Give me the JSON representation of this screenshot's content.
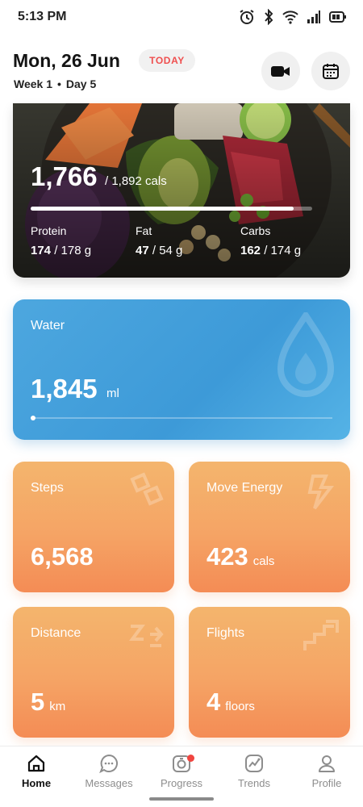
{
  "status_bar": {
    "time": "5:13 PM",
    "icons": [
      "alarm-icon",
      "bluetooth-icon",
      "wifi-icon",
      "signal-icon",
      "battery-icon"
    ]
  },
  "header": {
    "date": "Mon, 26 Jun",
    "badge": "TODAY",
    "week": "Week 1",
    "separator": "•",
    "day": "Day 5",
    "actions": [
      "video-camera-icon",
      "calendar-icon"
    ]
  },
  "calories": {
    "consumed": "1,766",
    "goal": "/ 1,892 cals",
    "progress_fraction": 0.933,
    "macros": [
      {
        "label": "Protein",
        "value": "174",
        "goal": " / 178 g"
      },
      {
        "label": "Fat",
        "value": "47",
        "goal": " / 54 g"
      },
      {
        "label": "Carbs",
        "value": "162",
        "goal": " / 174 g"
      }
    ]
  },
  "water": {
    "title": "Water",
    "value": "1,845",
    "unit": "ml",
    "icon": "water-drop-icon"
  },
  "stats": {
    "steps": {
      "title": "Steps",
      "value": "6,568",
      "unit": "",
      "icon": "steps-icon"
    },
    "move": {
      "title": "Move Energy",
      "value": "423",
      "unit": "cals",
      "icon": "lightning-icon"
    },
    "distance": {
      "title": "Distance",
      "value": "5",
      "unit": "km",
      "icon": "distance-icon"
    },
    "flights": {
      "title": "Flights",
      "value": "4",
      "unit": "floors",
      "icon": "stairs-icon"
    }
  },
  "nav": {
    "items": [
      {
        "label": "Home",
        "icon": "home-icon",
        "active": true
      },
      {
        "label": "Messages",
        "icon": "chat-icon",
        "active": false
      },
      {
        "label": "Progress",
        "icon": "camera-progress-icon",
        "active": false
      },
      {
        "label": "Trends",
        "icon": "trends-icon",
        "active": false
      },
      {
        "label": "Profile",
        "icon": "profile-icon",
        "active": false
      }
    ]
  },
  "colors": {
    "accent_red": "#ef4f4f",
    "water_blue": "#4da7df",
    "stat_orange": "#f5a465"
  }
}
